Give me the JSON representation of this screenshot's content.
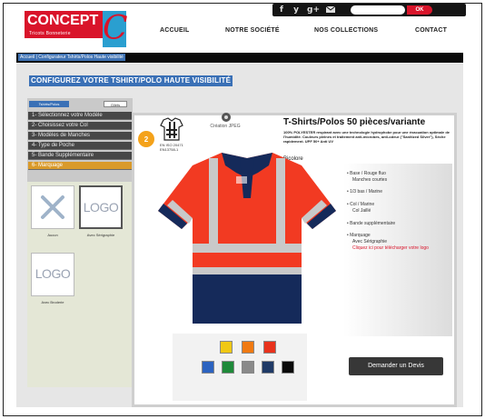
{
  "social": {
    "icons": [
      "f",
      "y",
      "g+",
      "mail"
    ],
    "search_placeholder": "",
    "search_button": "OK"
  },
  "logo": {
    "brand": "CONCEPT",
    "tagline": "Tricots Bonneterie",
    "mark": "C"
  },
  "nav": [
    "ACCUEIL",
    "NOTRE SOCIÉTÉ",
    "NOS COLLECTIONS",
    "CONTACT"
  ],
  "breadcrumb": "Accueil | Configurateur Tshirts/Polos Haute visibilité",
  "heading": "CONFIGUREZ VOTRE TSHIRT/POLO HAUTE VISIBILITÉ",
  "tabs": {
    "active": "Tshirts/Polos",
    "inactive": "Gilets"
  },
  "steps": [
    "1- Sélectionnez votre Modèle",
    "2- Choisissez votre Col",
    "3- Modèles de Manches",
    "4- Type de Poche",
    "5- Bande Supplémentaire",
    "6- Marquage"
  ],
  "options": [
    {
      "label": "Aucun"
    },
    {
      "label": "Avec Sérigraphie",
      "logo": "LOGO"
    },
    {
      "label": "Avec Broderie",
      "logo": "LOGO"
    }
  ],
  "product": {
    "title": "T-Shirts/Polos 50 pièces/variante",
    "description": "100% POLYESTER respirant avec une technologie hydrophobe pour une évacuation optimale de l'humidité. Couleurs pleines et traitement anti-microbes, anti-odeur (\"Sanitized Silver\"), Sèche rapidement. UPF 50+ Anti UV",
    "variant": "Bicolore",
    "creation": "Création JPEG",
    "norm": [
      "EN ISO 20471",
      "EN13758-1"
    ]
  },
  "specs": [
    {
      "label": "Base / Rouge fluo",
      "sub": "Manches courtes"
    },
    {
      "label": "1/3 bas / Marine",
      "sub": ""
    },
    {
      "label": "Col / Marine",
      "sub": "Col Jaillé"
    },
    {
      "label": "Bande supplémentaire",
      "sub": ""
    },
    {
      "label": "Marquage",
      "sub": "Avec Sérigraphie",
      "link": "Cliquez ici pour télécharger votre logo"
    }
  ],
  "swatch_colors": [
    "#f0c814",
    "#f07a12",
    "#e8321c",
    "#2c63c0",
    "#1f8a3a",
    "#8a8a8a",
    "#1f3a66",
    "#0a0a0a"
  ],
  "devis_button": "Demander un Devis"
}
